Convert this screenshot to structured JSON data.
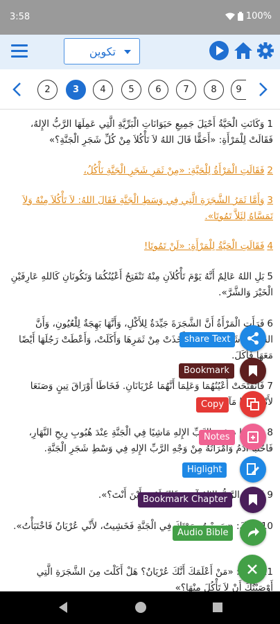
{
  "status": {
    "time": "3:58",
    "battery": "100%"
  },
  "toolbar": {
    "book": "تكوين"
  },
  "chapters": {
    "items": [
      "2",
      "3",
      "4",
      "5",
      "6",
      "7",
      "8",
      "9"
    ],
    "active": "3"
  },
  "verses": [
    {
      "n": "1",
      "text": "وَكَانَتِ الْحَيَّةُ أَحْيَلَ جَمِيعِ حَيَوَانَاتِ الْبَرِّيَّةِ الَّتِي عَمِلَهَا الرَّبُّ الإِلهُ، فَقَالَتْ لِلْمَرْأَةِ: «أَحَقًّا قَالَ اللهُ لاَ تَأْكُلاَ مِنْ كُلِّ شَجَرِ الْجَنَّةِ؟»",
      "hl": false
    },
    {
      "n": "2",
      "text": "فَقَالَتِ الْمَرْأَةُ لِلْحَيَّةِ: «مِنْ ثَمَرِ شَجَرِ الْجَنَّةِ نَأْكُلُ،",
      "hl": true
    },
    {
      "n": "3",
      "text": "وَأَمَّا ثَمَرُ الشَّجَرَةِ الَّتِي فِي وَسَطِ الْجَنَّةِ فَقَالَ اللهُ: لاَ تَأْكُلاَ مِنْهُ وَلاَ تَمَسَّاهُ لِئَلاَّ تَمُوتَا».",
      "hl": true
    },
    {
      "n": "4",
      "text": "فَقَالَتِ الْحَيَّةُ لِلْمَرْأَةِ: «لَنْ تَمُوتَا!",
      "hl": true
    },
    {
      "n": "5",
      "text": "بَلِ اللهُ عَالِمٌ أَنَّهُ يَوْمَ تَأْكُلاَنِ مِنْهُ تَنْفَتِحُ أَعْيُنُكُمَا وَتَكُونَانِ كَاللهِ عَارِفَيْنِ الْخَيْرَ وَالشَّرَّ».",
      "hl": false
    },
    {
      "n": "6",
      "text": "فَرَأَتِ الْمَرْأَةُ أَنَّ الشَّجَرَةَ جَيِّدَةٌ لِلأَكْلِ، وَأَنَّهَا بَهِجَةٌ لِلْعُيُونِ، وَأَنَّ الشَّجَرَةَ شَهِيَّةٌ لِلنَّظَرِ. فَأَخَذَتْ مِنْ ثَمَرِهَا وَأَكَلَتْ، وَأَعْطَتْ رَجُلَهَا أَيْضًا مَعَهَا فَأَكَلَ.",
      "hl": false
    },
    {
      "n": "7",
      "text": "فَانْفَتَحَتْ أَعْيُنُهُمَا وَعَلِمَا أَنَّهُمَا عُرْيَانَانِ. فَخَاطَا أَوْرَاقَ تِينٍ وَصَنَعَا لأَنْفُسِهِمَا مَآزِرَ.",
      "hl": false
    },
    {
      "n": "8",
      "text": "وَسَمِعَا صَوْتَ الرَّبِّ الإِلهِ مَاشِيًا فِي الْجَنَّةِ عِنْدَ هُبُوبِ رِيحِ النَّهَارِ، فَاخْتَبَأَ آدَمُ وَامْرَأَتُهُ مِنْ وَجْهِ الرَّبِّ الإِلهِ فِي وَسْطِ شَجَرِ الْجَنَّةِ.",
      "hl": false
    },
    {
      "n": "9",
      "text": "فَنَادَى الرَّبُّ الإِلهُ آدَمَ وَقَالَ لَهُ: «أَيْنَ أَنْتَ؟».",
      "hl": false
    },
    {
      "n": "10",
      "text": "فَقَالَ: «سَمِعْتُ صَوْتَكَ فِي الْجَنَّةِ فَخَشِيتُ، لأَنِّي عُرْيَانٌ فَاخْتَبَأْتُ».",
      "hl": false
    },
    {
      "n": "11",
      "text": "فَقَالَ: «مَنْ أَعْلَمَكَ أَنَّكَ عُرْيَانٌ؟ هَلْ أَكَلْتَ مِنَ الشَّجَرَةِ الَّتِي أَوْصَيْتُكَ أَنْ لاَ تَأْكُلَ مِنْهَا؟»",
      "hl": false
    }
  ],
  "actions": {
    "share": "share Text",
    "bookmark": "Bookmark",
    "copy": "Copy",
    "notes": "Notes",
    "highlight": "Higlight",
    "bookmark_chapter": "Bookmark Chapter",
    "audio": "Audio Bible"
  },
  "colors": {
    "accent": "#1f6fd1",
    "highlight_text": "#e08a1a",
    "share": "#1e88e5",
    "bookmark": "#5d1f1f",
    "copy": "#e53935",
    "notes": "#f06292",
    "highlight": "#1e88e5",
    "bookmark_chapter": "#4a1e5a",
    "audio": "#43a047",
    "close": "#43a047"
  }
}
